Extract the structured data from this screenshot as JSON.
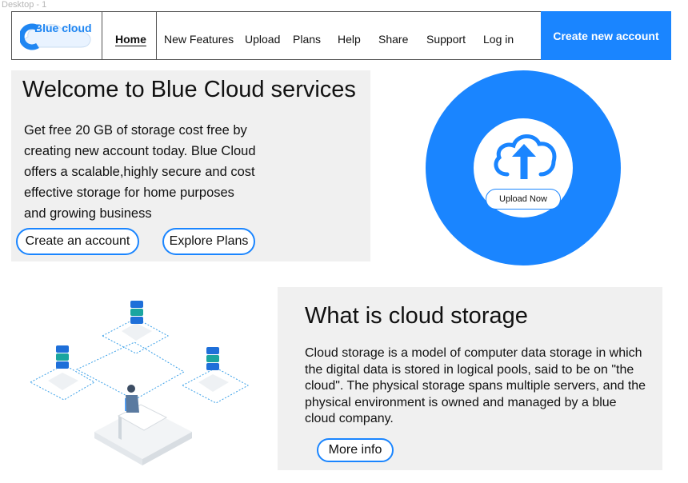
{
  "frame_label": "Desktop - 1",
  "brand": {
    "logo_text": "Blue cloud",
    "accent": "#1a85ff"
  },
  "nav": {
    "items": [
      "Home",
      "New Features",
      "Upload",
      "Plans",
      "Help",
      "Share",
      "Support",
      "Log in"
    ],
    "cta": "Create new account"
  },
  "hero": {
    "title": "Welcome to Blue Cloud services",
    "body": "Get free 20 GB of storage cost free by creating new account today. Blue Cloud offers a scalable,highly secure and cost effective storage for home purposes and growing business",
    "primary_button": "Create an account",
    "secondary_button": "Explore Plans"
  },
  "upload": {
    "button_label": "Upload Now",
    "icon": "cloud-upload-icon"
  },
  "illustration": {
    "icon": "cloud-server-network-illustration"
  },
  "info": {
    "title": "What is cloud storage",
    "body": "Cloud storage is a model of computer data storage in which the digital data is stored in logical pools, said to be on \"the cloud\". The physical storage spans multiple servers, and the physical environment is owned and managed by a blue cloud company.",
    "button": "More info"
  }
}
